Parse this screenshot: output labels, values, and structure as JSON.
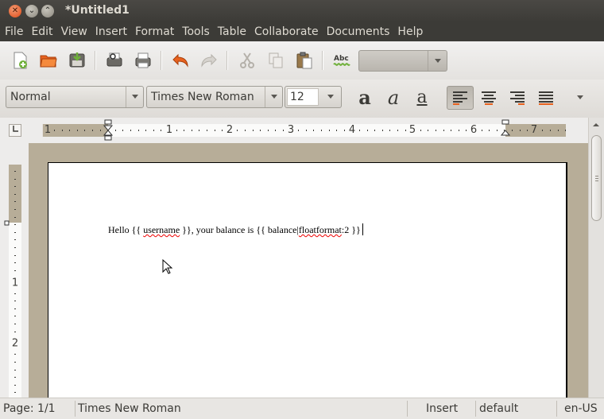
{
  "window": {
    "title": "*Untitled1"
  },
  "menubar": {
    "items": [
      "File",
      "Edit",
      "View",
      "Insert",
      "Format",
      "Tools",
      "Table",
      "Collaborate",
      "Documents",
      "Help"
    ]
  },
  "toolbar": {
    "buttons": [
      "new-document-icon",
      "open-folder-icon",
      "save-icon",
      "print-preview-icon",
      "print-icon",
      "undo-icon",
      "redo-icon",
      "cut-icon",
      "copy-icon",
      "paste-icon",
      "spellcheck-icon"
    ],
    "spellcheck_label": "Abc",
    "zoom_value": ""
  },
  "format": {
    "style": "Normal",
    "font": "Times New Roman",
    "size": "12",
    "bold_glyph": "a",
    "italic_glyph": "a",
    "underline_glyph": "a",
    "alignment": "left"
  },
  "ruler": {
    "horizontal_labels": [
      "1",
      "1",
      "2",
      "3",
      "4",
      "5",
      "6",
      "7"
    ],
    "vertical_labels": [
      "1",
      "2"
    ]
  },
  "document": {
    "text_parts": [
      "Hello {{ ",
      "username",
      " }}, your balance is {{ balance|",
      "floatformat",
      ":2 }}"
    ]
  },
  "statusbar": {
    "page": "Page: 1/1",
    "font": "Times New Roman",
    "mode": "Insert",
    "style": "default",
    "language": "en-US"
  },
  "colors": {
    "titlebar": "#3c3b37",
    "close_button": "#df4a16",
    "margin": "#b7ad98",
    "spell_error": "#e00000"
  }
}
